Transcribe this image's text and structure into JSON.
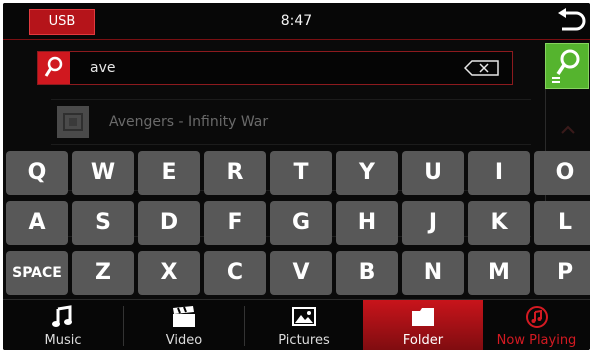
{
  "status": {
    "source": "USB",
    "time": "8:47"
  },
  "search": {
    "query": "ave"
  },
  "results": [
    {
      "title": "Avengers - Infinity War"
    }
  ],
  "keyboard": {
    "rows": [
      [
        "Q",
        "W",
        "E",
        "R",
        "T",
        "Y",
        "U",
        "I",
        "O"
      ],
      [
        "A",
        "S",
        "D",
        "F",
        "G",
        "H",
        "J",
        "K",
        "L"
      ],
      [
        "SPACE",
        "Z",
        "X",
        "C",
        "V",
        "B",
        "N",
        "M",
        "P"
      ]
    ]
  },
  "nav": {
    "items": [
      {
        "label": "Music",
        "icon": "music-note-icon"
      },
      {
        "label": "Video",
        "icon": "clapperboard-icon"
      },
      {
        "label": "Pictures",
        "icon": "picture-icon"
      },
      {
        "label": "Folder",
        "icon": "folder-icon",
        "active": true
      },
      {
        "label": "Now Playing",
        "icon": "now-playing-icon"
      }
    ]
  },
  "colors": {
    "accent": "#c8141b",
    "search_go": "#55b42e",
    "key": "#585858",
    "background": "#0a0a0a"
  }
}
